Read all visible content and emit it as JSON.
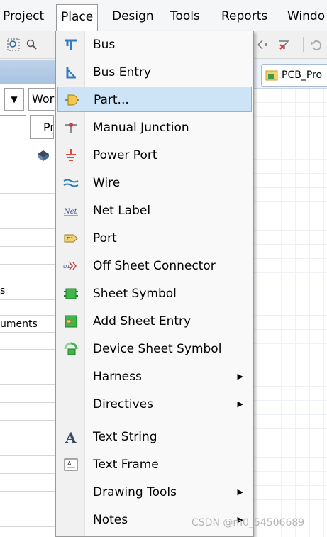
{
  "menubar": {
    "items": [
      {
        "label": "Project"
      },
      {
        "label": "Place"
      },
      {
        "label": "Design"
      },
      {
        "label": "Tools"
      },
      {
        "label": "Reports"
      },
      {
        "label": "Windo"
      }
    ]
  },
  "left_panel": {
    "combo1": "Wor",
    "combo2": "Pr",
    "row_texts": [
      "s",
      "uments"
    ]
  },
  "doc_tab": {
    "label": "PCB_Pro"
  },
  "place_menu": {
    "items": [
      {
        "label": "Bus",
        "icon": "bus-icon"
      },
      {
        "label": "Bus Entry",
        "icon": "bus-entry-icon"
      },
      {
        "label": "Part...",
        "icon": "part-icon"
      },
      {
        "label": "Manual Junction",
        "icon": "junction-icon"
      },
      {
        "label": "Power Port",
        "icon": "power-port-icon"
      },
      {
        "label": "Wire",
        "icon": "wire-icon"
      },
      {
        "label": "Net Label",
        "icon": "net-label-icon"
      },
      {
        "label": "Port",
        "icon": "port-icon"
      },
      {
        "label": "Off Sheet Connector",
        "icon": "off-sheet-connector-icon"
      },
      {
        "label": "Sheet Symbol",
        "icon": "sheet-symbol-icon"
      },
      {
        "label": "Add Sheet Entry",
        "icon": "sheet-entry-icon"
      },
      {
        "label": "Device Sheet Symbol",
        "icon": "device-sheet-symbol-icon"
      },
      {
        "label": "Harness",
        "icon": ""
      },
      {
        "label": "Directives",
        "icon": ""
      },
      {
        "label": "Text String",
        "icon": "text-string-icon"
      },
      {
        "label": "Text Frame",
        "icon": "text-frame-icon"
      },
      {
        "label": "Drawing Tools",
        "icon": ""
      },
      {
        "label": "Notes",
        "icon": ""
      }
    ],
    "highlighted": "Part..."
  },
  "watermark": "CSDN @m0_54506689",
  "colors": {
    "highlight": "#cde4f7",
    "highlight_border": "#84b9e6",
    "bus_blue": "#2e7cc4",
    "power_red": "#e04a3a"
  }
}
